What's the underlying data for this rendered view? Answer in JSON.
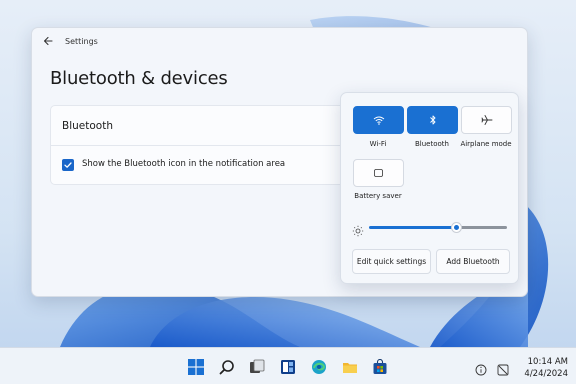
{
  "settings": {
    "window_title": "Settings",
    "page_title": "Bluetooth & devices",
    "section_title": "Bluetooth",
    "checkbox_label": "Show the Bluetooth icon in the notification area",
    "checkbox_checked": true
  },
  "quick_settings": {
    "tiles": [
      {
        "label": "Wi-Fi",
        "icon": "wifi-icon",
        "active": true
      },
      {
        "label": "Bluetooth",
        "icon": "bluetooth-icon",
        "active": true
      },
      {
        "label": "Airplane mode",
        "icon": "airplane-icon",
        "active": false
      },
      {
        "label": "Battery saver",
        "icon": "battery-saver-icon",
        "active": false
      }
    ],
    "brightness_level": 0.64,
    "edit_button": "Edit quick settings",
    "add_bluetooth_button": "Add Bluetooth"
  },
  "taskbar": {
    "apps": [
      "start-icon",
      "search-icon",
      "task-view-icon",
      "widgets-icon",
      "edge-icon",
      "file-explorer-icon",
      "store-icon"
    ],
    "tray_icons": [
      "info-icon",
      "notification-off-icon"
    ],
    "time": "10:14 AM",
    "date": "4/24/2024"
  },
  "colors": {
    "accent": "#1a70d2",
    "checkbox": "#1a66c9"
  }
}
